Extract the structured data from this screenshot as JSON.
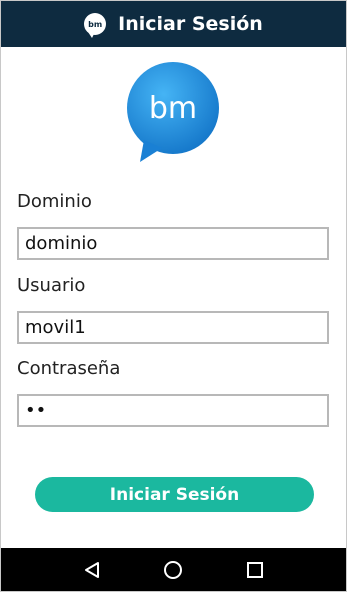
{
  "topbar": {
    "icon_text": "bm",
    "title": "Iniciar Sesión"
  },
  "logo": {
    "text": "bm",
    "color": "#1e8fde"
  },
  "form": {
    "domain_label": "Dominio",
    "domain_value": "dominio",
    "user_label": "Usuario",
    "user_value": "movil1",
    "password_label": "Contraseña",
    "password_value": "••"
  },
  "login_button": {
    "label": "Iniciar Sesión",
    "color": "#1bb89f"
  },
  "navbar": {
    "back_icon": "back-triangle-icon",
    "home_icon": "home-circle-icon",
    "recents_icon": "recents-square-icon"
  },
  "colors": {
    "topbar_bg": "#0e2b40",
    "navbar_bg": "#000000"
  }
}
